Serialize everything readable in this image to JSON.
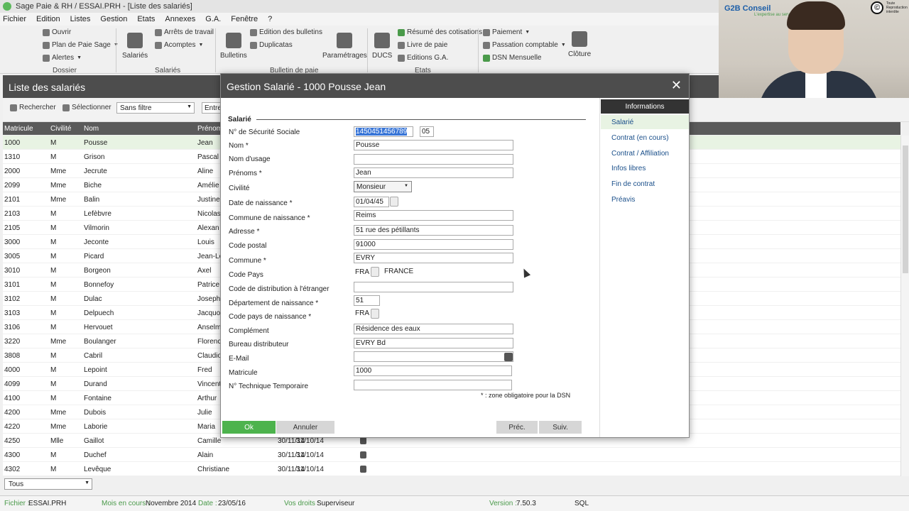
{
  "window": {
    "title": "Sage Paie & RH / ESSAI.PRH - [Liste des salariés]"
  },
  "menu": [
    "Fichier",
    "Edition",
    "Listes",
    "Gestion",
    "Etats",
    "Annexes",
    "G.A.",
    "Fenêtre",
    "?"
  ],
  "ribbon": {
    "dossier": {
      "label": "Dossier",
      "items": [
        "Ouvrir",
        "Plan de Paie Sage",
        "Alertes"
      ]
    },
    "salaries": {
      "label": "Salariés",
      "big": "Salariés",
      "items": [
        "Arrêts de travail",
        "Acomptes"
      ]
    },
    "bulletin": {
      "label": "Bulletin de paie",
      "big": "Bulletins",
      "items": [
        "Edition des bulletins",
        "Duplicatas"
      ],
      "param": "Paramétrages"
    },
    "etats": {
      "label": "Etats",
      "big": "DUCS",
      "items": [
        "Résumé des cotisations",
        "Livre de paie",
        "Editions G.A."
      ]
    },
    "right": {
      "items": [
        "Paiement",
        "Passation comptable",
        "DSN Mensuelle"
      ],
      "cloture": "Clôture"
    }
  },
  "video": {
    "logo": "G2B Conseil",
    "tagline": "L'expertise au service de votre croissance",
    "copyright": "Toute Reproduction interdite"
  },
  "list": {
    "title": "Liste des salariés",
    "search_label": "Rechercher",
    "select_label": "Sélectionner",
    "filter": "Sans filtre",
    "entrez": "Entrez",
    "columns": [
      "Matricule",
      "Civilité",
      "Nom",
      "Prénom"
    ],
    "rows": [
      {
        "m": "1000",
        "c": "M",
        "n": "Pousse",
        "p": "Jean"
      },
      {
        "m": "1310",
        "c": "M",
        "n": "Grison",
        "p": "Pascal"
      },
      {
        "m": "2000",
        "c": "Mme",
        "n": "Jecrute",
        "p": "Aline"
      },
      {
        "m": "2099",
        "c": "Mme",
        "n": "Biche",
        "p": "Amélie"
      },
      {
        "m": "2101",
        "c": "Mme",
        "n": "Balin",
        "p": "Justine"
      },
      {
        "m": "2103",
        "c": "M",
        "n": "Lefèbvre",
        "p": "Nicolas"
      },
      {
        "m": "2105",
        "c": "M",
        "n": "Vilmorin",
        "p": "Alexan"
      },
      {
        "m": "3000",
        "c": "M",
        "n": "Jeconte",
        "p": "Louis"
      },
      {
        "m": "3005",
        "c": "M",
        "n": "Picard",
        "p": "Jean-Lo"
      },
      {
        "m": "3010",
        "c": "M",
        "n": "Borgeon",
        "p": "Axel"
      },
      {
        "m": "3101",
        "c": "M",
        "n": "Bonnefoy",
        "p": "Patrice"
      },
      {
        "m": "3102",
        "c": "M",
        "n": "Dulac",
        "p": "Joseph"
      },
      {
        "m": "3103",
        "c": "M",
        "n": "Delpuech",
        "p": "Jacquo"
      },
      {
        "m": "3106",
        "c": "M",
        "n": "Hervouet",
        "p": "Anselm"
      },
      {
        "m": "3220",
        "c": "Mme",
        "n": "Boulanger",
        "p": "Florenc"
      },
      {
        "m": "3808",
        "c": "M",
        "n": "Cabril",
        "p": "Claudio"
      },
      {
        "m": "4000",
        "c": "M",
        "n": "Lepoint",
        "p": "Fred"
      },
      {
        "m": "4099",
        "c": "M",
        "n": "Durand",
        "p": "Vincent"
      },
      {
        "m": "4100",
        "c": "M",
        "n": "Fontaine",
        "p": "Arthur"
      },
      {
        "m": "4200",
        "c": "Mme",
        "n": "Dubois",
        "p": "Julie"
      },
      {
        "m": "4220",
        "c": "Mme",
        "n": "Laborie",
        "p": "Maria"
      },
      {
        "m": "4250",
        "c": "Mlle",
        "n": "Gaillot",
        "p": "Camille",
        "d1": "30/11/14",
        "d2": "31/10/14"
      },
      {
        "m": "4300",
        "c": "M",
        "n": "Duchef",
        "p": "Alain",
        "d1": "30/11/14",
        "d2": "31/10/14"
      },
      {
        "m": "4302",
        "c": "M",
        "n": "Levêque",
        "p": "Christiane",
        "d1": "30/11/14",
        "d2": "31/10/14"
      }
    ],
    "bottom_filter": "Tous"
  },
  "status": {
    "fichier_label": "Fichier :",
    "fichier": "ESSAI.PRH",
    "mois_label": "Mois en cours :",
    "mois": "Novembre 2014",
    "date_label": "Date :",
    "date": "23/05/16",
    "droits_label": "Vos droits :",
    "droits": "Superviseur",
    "version_label": "Version :",
    "version": "7.50.3",
    "db": "SQL"
  },
  "dialog": {
    "title": "Gestion Salarié - 1000 Pousse Jean",
    "close": "✕",
    "section": "Salarié",
    "labels": {
      "secu": "N° de Sécurité Sociale",
      "nom": "Nom *",
      "usage": "Nom d'usage",
      "prenoms": "Prénoms *",
      "civilite": "Civilité",
      "naissance": "Date de naissance *",
      "commune_naiss": "Commune de naissance *",
      "adresse": "Adresse *",
      "cp": "Code postal",
      "commune": "Commune *",
      "pays": "Code Pays",
      "distrib": "Code de distribution à l'étranger",
      "dept": "Département de naissance *",
      "pays_naiss": "Code pays de naissance *",
      "complement": "Complément",
      "bureau": "Bureau distributeur",
      "email": "E-Mail",
      "matricule": "Matricule",
      "ntt": "N° Technique Temporaire"
    },
    "values": {
      "secu": "1450451456789",
      "secu_key": "05",
      "nom": "Pousse",
      "usage": "",
      "prenoms": "Jean",
      "civilite": "Monsieur",
      "naissance": "01/04/45",
      "commune_naiss": "Reims",
      "adresse": "51 rue des pétillants",
      "cp": "91000",
      "commune": "EVRY",
      "pays": "FRA",
      "pays_name": "FRANCE",
      "distrib": "",
      "dept": "51",
      "pays_naiss": "FRA",
      "complement": "Résidence des eaux",
      "bureau": "EVRY Bd",
      "email": "",
      "matricule": "1000",
      "ntt": ""
    },
    "footnote": "* : zone obligatoire pour la DSN",
    "buttons": {
      "ok": "Ok",
      "cancel": "Annuler",
      "prev": "Préc.",
      "next": "Suiv."
    },
    "side": {
      "header": "Informations",
      "items": [
        "Salarié",
        "Contrat (en cours)",
        "Contrat / Affiliation",
        "Infos libres",
        "Fin de contrat",
        "Préavis"
      ]
    }
  }
}
